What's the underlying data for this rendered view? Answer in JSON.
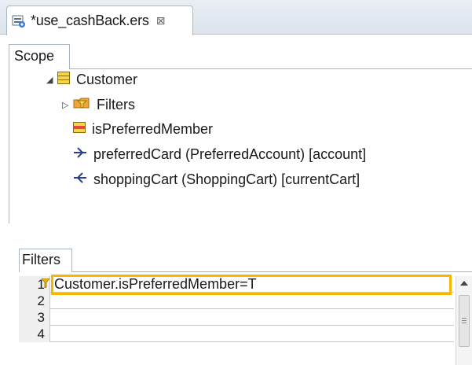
{
  "editor": {
    "tab_title": "*use_cashBack.ers",
    "close_glyph": "⊠"
  },
  "scope": {
    "tab_label": "Scope",
    "tree": [
      {
        "label": "Customer",
        "icon": "entity-icon",
        "expanded": true
      },
      {
        "label": "Filters",
        "icon": "filters-folder-icon",
        "expanded": false
      },
      {
        "label": "isPreferredMember",
        "icon": "attribute-icon"
      },
      {
        "label": "preferredCard (PreferredAccount) [account]",
        "icon": "outgoing-relation-icon"
      },
      {
        "label": "shoppingCart (ShoppingCart) [currentCart]",
        "icon": "incoming-relation-icon"
      }
    ]
  },
  "filters": {
    "tab_label": "Filters",
    "rows": [
      {
        "num": "1",
        "value": "Customer.isPreferredMember=T",
        "has_filter_icon": true,
        "selected": true
      },
      {
        "num": "2",
        "value": ""
      },
      {
        "num": "3",
        "value": ""
      },
      {
        "num": "4",
        "value": ""
      }
    ]
  },
  "colors": {
    "highlight": "#f5b800",
    "entity_icon": "#f0c419",
    "attribute_icon": "#e8463f",
    "relation_icon": "#2a3f8f"
  }
}
